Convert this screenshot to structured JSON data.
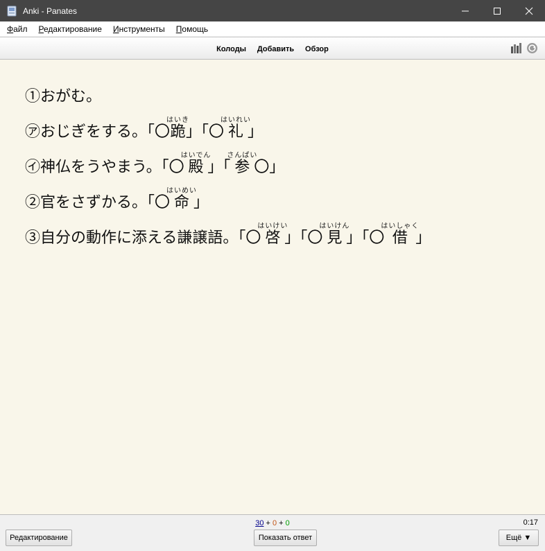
{
  "window": {
    "title": "Anki - Panates"
  },
  "menu": [
    {
      "accel": "Ф",
      "rest": "айл"
    },
    {
      "accel": "Р",
      "rest": "едактирование"
    },
    {
      "accel": "И",
      "rest": "нструменты"
    },
    {
      "accel": "П",
      "rest": "омощь"
    }
  ],
  "toolbar": {
    "decks": "Колоды",
    "add": "Добавить",
    "browse": "Обзор"
  },
  "card": {
    "l1": {
      "text": "①おがむ。"
    },
    "l2": {
      "prefix": "㋐おじぎをする。「〇",
      "k1": "跪",
      "r1": "はいき",
      "mid": "」「〇",
      "k2": "礼",
      "r2": "はいれい",
      "suffix": "」"
    },
    "l3": {
      "prefix": "㋑神仏をうやまう。「〇",
      "k1": "殿",
      "r1": "はいでん",
      "mid": "」「",
      "k2": "参",
      "r2": "さんぱい",
      "suffix": "〇」"
    },
    "l4": {
      "prefix": "②官をさずかる。「〇",
      "k1": "命",
      "r1": "はいめい",
      "suffix": "」"
    },
    "l5": {
      "prefix": "③自分の動作に添える謙譲語。「〇",
      "k1": "啓",
      "r1": "はいけい",
      "mid1": "」「〇",
      "k2": "見",
      "r2": "はいけん",
      "mid2": "」「〇",
      "k3": "借",
      "r3": "はいしゃく",
      "suffix": "」"
    }
  },
  "bottom": {
    "counts": {
      "new": "30",
      "plus1": " + ",
      "learn": "0",
      "plus2": " + ",
      "review": "0"
    },
    "timer": "0:17",
    "edit": "Редактирование",
    "show_answer": "Показать ответ",
    "more": "Ещё ▼"
  }
}
